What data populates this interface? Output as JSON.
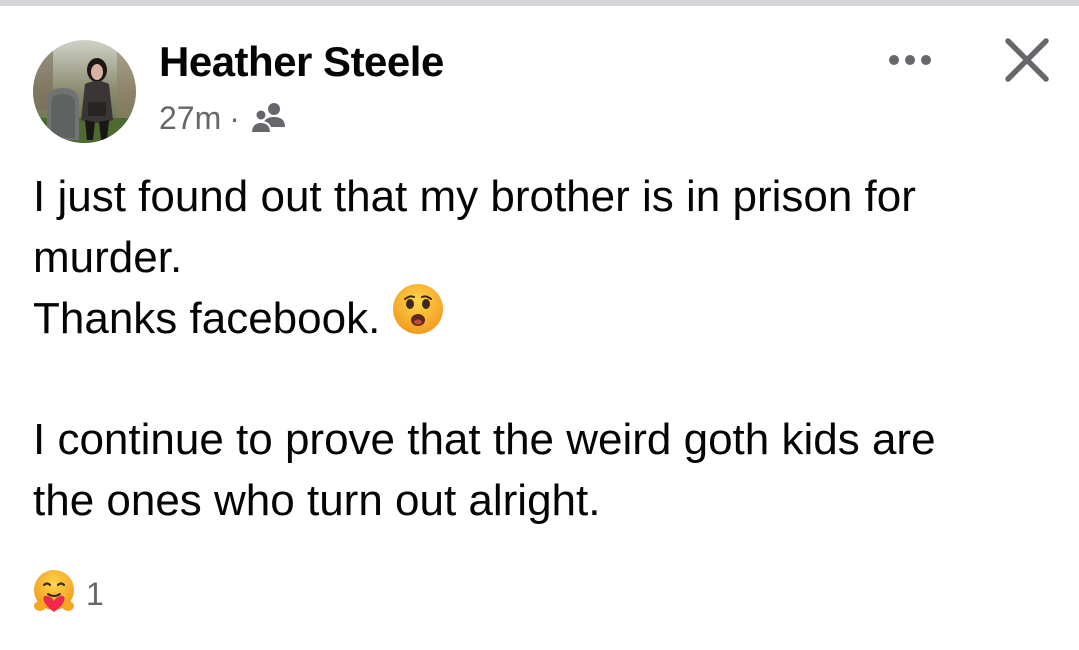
{
  "post": {
    "author": {
      "name": "Heather Steele",
      "avatar_icon": "profile-photo"
    },
    "meta": {
      "time": "27m",
      "separator": "·",
      "audience_icon": "friends-icon"
    },
    "actions": {
      "more_icon": "more-options-icon",
      "close_icon": "close-icon"
    },
    "body": {
      "line1": "I just found out that my brother is in prison for",
      "line2": "murder.",
      "line3": "Thanks facebook.",
      "line3_emoji": "frowning-face-open-mouth-emoji",
      "line5": "I continue to prove that the weird goth kids are",
      "line6": "the ones who turn out alright."
    },
    "reactions": {
      "icon": "care-reaction-icon",
      "count": "1"
    }
  },
  "colors": {
    "text_primary": "#050505",
    "text_secondary": "#65676b",
    "top_divider": "#d4d6da",
    "emoji_yellow": "#f7b125"
  }
}
